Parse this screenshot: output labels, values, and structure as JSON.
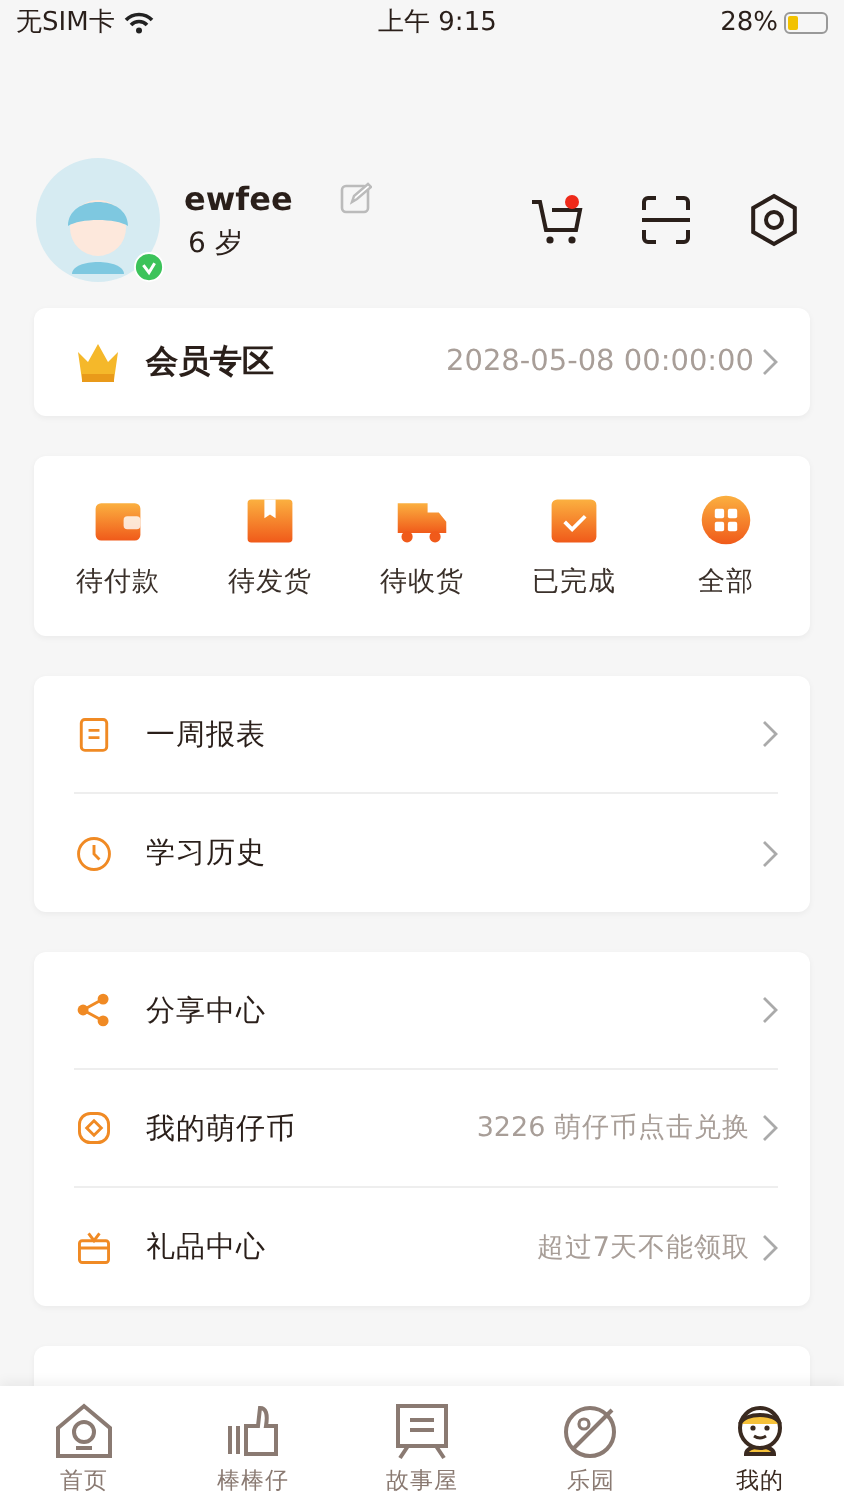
{
  "status_bar": {
    "carrier": "无SIM卡",
    "time": "上午 9:15",
    "battery": "28%"
  },
  "profile": {
    "name": "ewfee",
    "age": "6 岁",
    "verified": true,
    "cart_badge": true
  },
  "membership": {
    "title": "会员专区",
    "expiry": "2028-05-08 00:00:00"
  },
  "orders": [
    {
      "kind": "wallet",
      "label": "待付款"
    },
    {
      "kind": "box",
      "label": "待发货"
    },
    {
      "kind": "truck",
      "label": "待收货"
    },
    {
      "kind": "done",
      "label": "已完成"
    },
    {
      "kind": "all",
      "label": "全部"
    }
  ],
  "menu_groups": [
    [
      {
        "kind": "report",
        "label": "一周报表"
      },
      {
        "kind": "history",
        "label": "学习历史"
      }
    ],
    [
      {
        "kind": "share",
        "label": "分享中心"
      },
      {
        "kind": "coin",
        "label": "我的萌仔币",
        "value": "3226 萌仔币点击兑换"
      },
      {
        "kind": "gift",
        "label": "礼品中心",
        "value": "超过7天不能领取"
      }
    ]
  ],
  "tabs": [
    {
      "kind": "home",
      "label": "首页",
      "selected": false
    },
    {
      "kind": "thumb",
      "label": "棒棒仔",
      "selected": false
    },
    {
      "kind": "story",
      "label": "故事屋",
      "selected": false
    },
    {
      "kind": "park",
      "label": "乐园",
      "selected": false
    },
    {
      "kind": "me",
      "label": "我的",
      "selected": true
    }
  ]
}
